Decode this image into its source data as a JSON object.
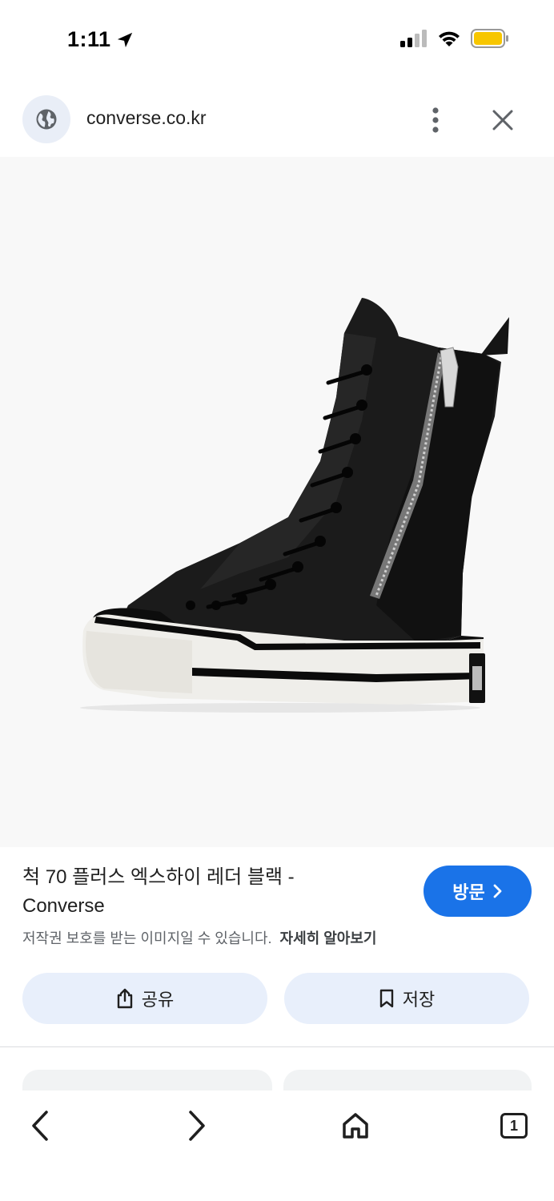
{
  "status_bar": {
    "time": "1:11"
  },
  "url_bar": {
    "url": "converse.co.kr"
  },
  "result": {
    "title": "척 70 플러스 엑스하이 레더 블랙 - Converse",
    "copyright_notice": "저작권 보호를 받는 이미지일 수 있습니다.",
    "learn_more": "자세히 알아보기",
    "visit_label": "방문"
  },
  "actions": {
    "share_label": "공유",
    "save_label": "저장"
  },
  "toolbar": {
    "tab_count": "1"
  },
  "colors": {
    "accent": "#1a73e8",
    "action_bg": "#e8effb",
    "battery": "#f7c600"
  }
}
